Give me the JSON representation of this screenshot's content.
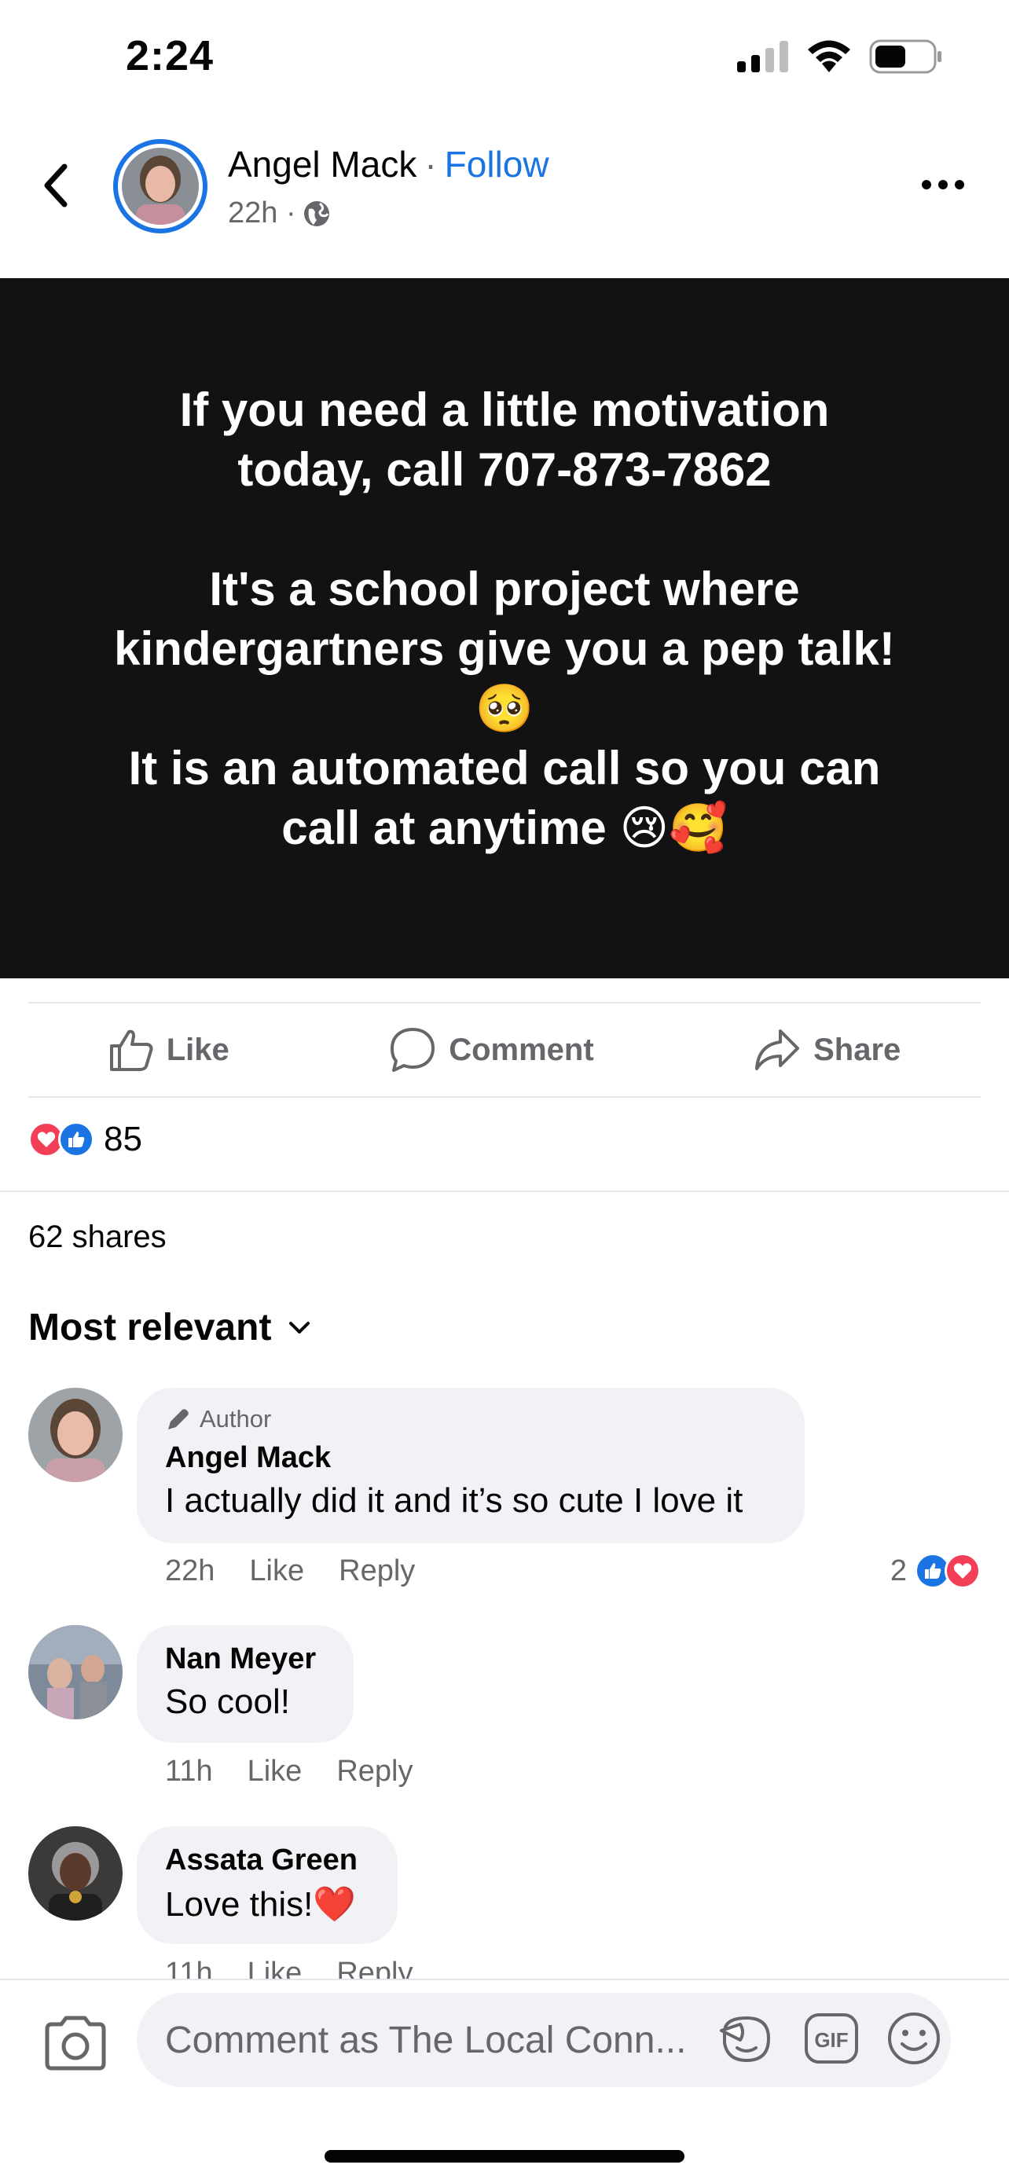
{
  "status": {
    "time": "2:24"
  },
  "post": {
    "author": "Angel Mack",
    "separator": "·",
    "follow": "Follow",
    "time": "22h ·",
    "lines_block1": [
      "If you need a little motivation",
      "today, call 707-873-7862"
    ],
    "lines_block2": [
      "It's a school project where",
      "kindergartners give you a pep talk!",
      "🥺",
      "It is an automated call so you can",
      "call at anytime 😢🥰"
    ]
  },
  "actions": {
    "like": "Like",
    "comment": "Comment",
    "share": "Share"
  },
  "reactions": {
    "count": "85"
  },
  "shares": "62 shares",
  "sort_label": "Most relevant",
  "comments": [
    {
      "badge": "Author",
      "name": "Angel Mack",
      "text": "I actually did it and it’s so cute I love it",
      "time": "22h",
      "like": "Like",
      "reply": "Reply",
      "reaction_count": "2"
    },
    {
      "name": "Nan Meyer",
      "text": "So cool!",
      "time": "11h",
      "like": "Like",
      "reply": "Reply"
    },
    {
      "name": "Assata Green",
      "text": "Love this!❤️",
      "time": "11h",
      "like": "Like",
      "reply": "Reply"
    }
  ],
  "composer": {
    "placeholder": "Comment as The Local Conn..."
  },
  "colors": {
    "accent": "#1b74e4",
    "post_bg": "#121212",
    "bubble": "#f0f2f5",
    "muted": "#65676b"
  },
  "icons": [
    "signal-icon",
    "wifi-icon",
    "battery-icon",
    "back-icon",
    "globe-icon",
    "more-icon",
    "like-icon",
    "comment-icon",
    "share-icon",
    "love-reaction-icon",
    "like-reaction-icon",
    "chevron-down-icon",
    "pencil-icon",
    "camera-icon",
    "sticker-icon",
    "gif-icon",
    "emoji-icon"
  ]
}
